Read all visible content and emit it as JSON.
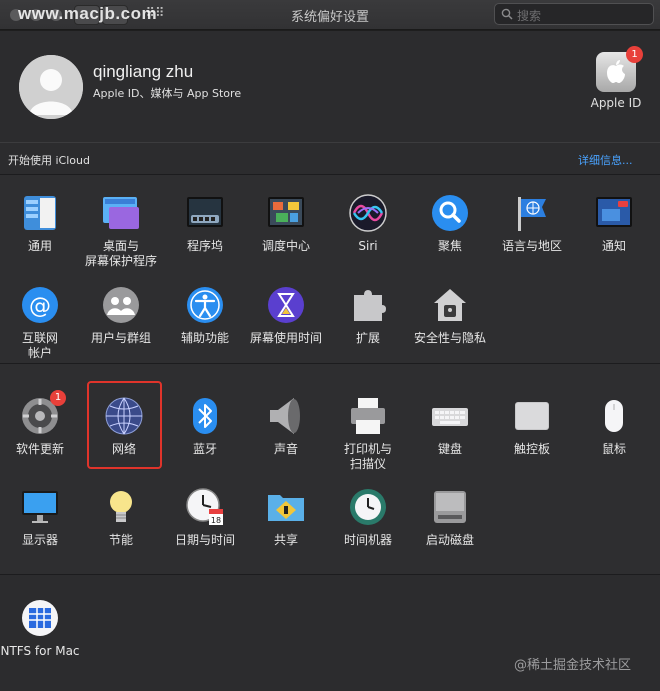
{
  "window": {
    "title": "系统偏好设置",
    "watermark": "www.macjb.com",
    "search_placeholder": "搜索"
  },
  "account": {
    "name": "qingliang zhu",
    "subtitle": "Apple ID、媒体与 App Store",
    "apple_id_label": "Apple ID",
    "apple_id_badge": "1"
  },
  "icloud": {
    "label": "开始使用 iCloud",
    "details_link": "详细信息..."
  },
  "row1": [
    "通用",
    "桌面与\n屏幕保护程序",
    "程序坞",
    "调度中心",
    "Siri",
    "聚焦",
    "语言与地区",
    "通知"
  ],
  "row2": [
    "互联网\n帐户",
    "用户与群组",
    "辅助功能",
    "屏幕使用时间",
    "扩展",
    "安全性与隐私"
  ],
  "row3": [
    "软件更新",
    "网络",
    "蓝牙",
    "声音",
    "打印机与\n扫描仪",
    "键盘",
    "触控板",
    "鼠标"
  ],
  "row4": [
    "显示器",
    "节能",
    "日期与时间",
    "共享",
    "时间机器",
    "启动磁盘"
  ],
  "row5": [
    "NTFS for Mac"
  ],
  "badges": {
    "software_update": "1"
  },
  "footer_credit": "@稀土掘金技术社区"
}
